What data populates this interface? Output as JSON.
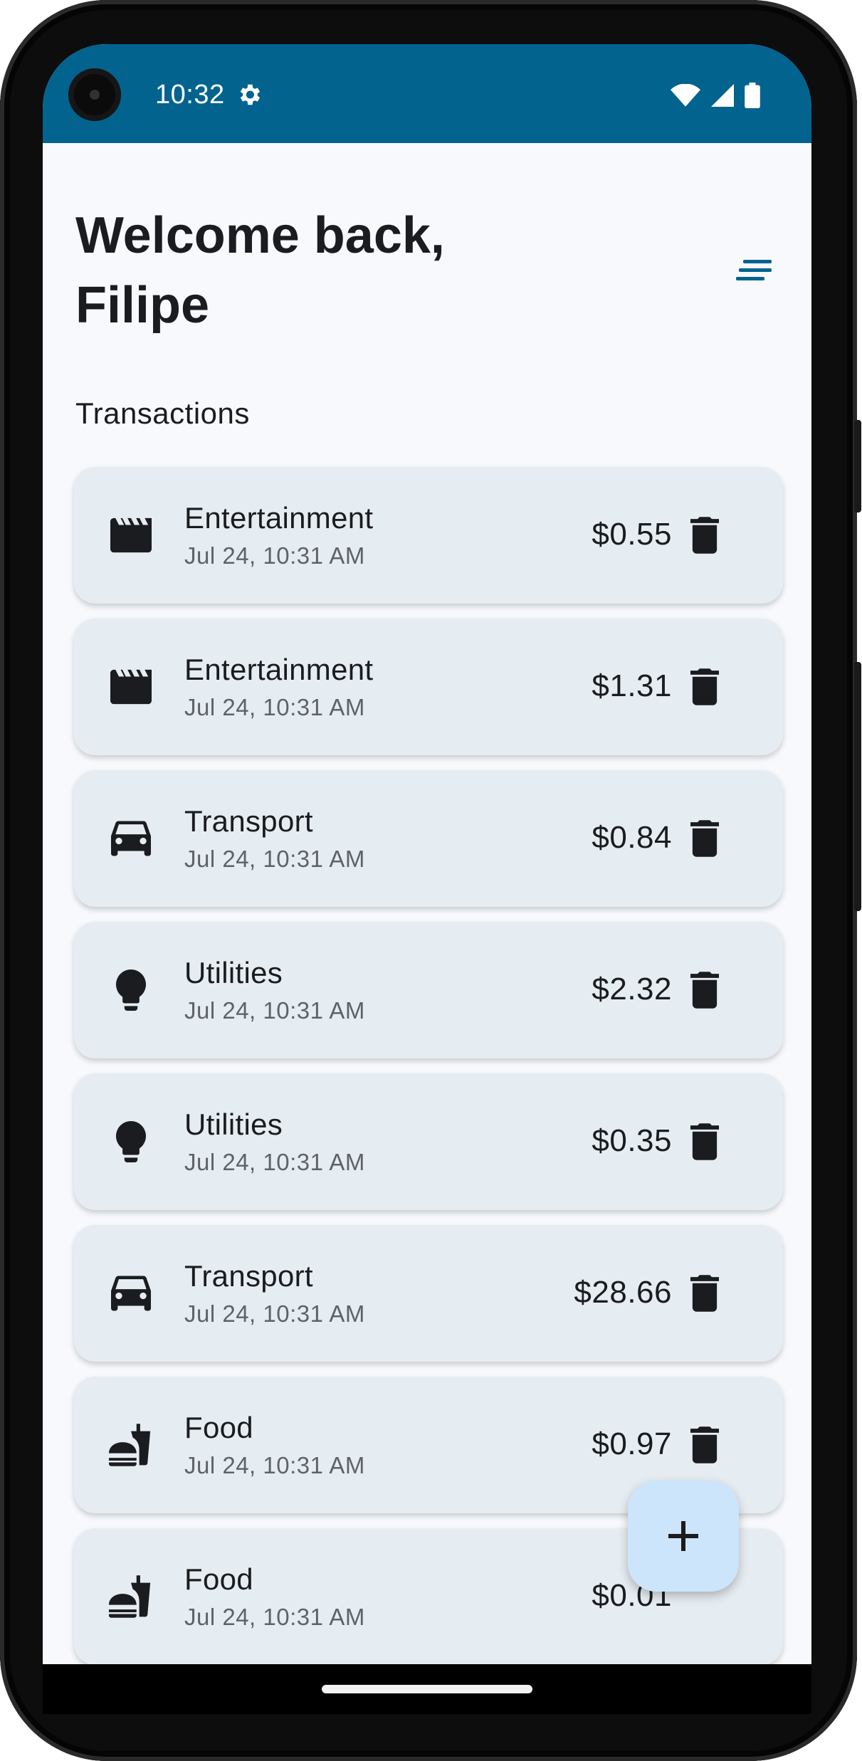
{
  "status_bar": {
    "time": "10:32",
    "icons": [
      "settings-gear-icon",
      "wifi-icon",
      "cellular-signal-icon",
      "battery-icon"
    ],
    "background_color": "#02638f"
  },
  "header": {
    "title": "Welcome back, Filipe",
    "sort_icon": "sort-icon"
  },
  "section": {
    "label": "Transactions"
  },
  "transactions": [
    {
      "category": "Entertainment",
      "date": "Jul 24, 10:31 AM",
      "amount": "$0.55",
      "icon": "movie-clapperboard-icon"
    },
    {
      "category": "Entertainment",
      "date": "Jul 24, 10:31 AM",
      "amount": "$1.31",
      "icon": "movie-clapperboard-icon"
    },
    {
      "category": "Transport",
      "date": "Jul 24, 10:31 AM",
      "amount": "$0.84",
      "icon": "car-icon"
    },
    {
      "category": "Utilities",
      "date": "Jul 24, 10:31 AM",
      "amount": "$2.32",
      "icon": "lightbulb-icon"
    },
    {
      "category": "Utilities",
      "date": "Jul 24, 10:31 AM",
      "amount": "$0.35",
      "icon": "lightbulb-icon"
    },
    {
      "category": "Transport",
      "date": "Jul 24, 10:31 AM",
      "amount": "$28.66",
      "icon": "car-icon"
    },
    {
      "category": "Food",
      "date": "Jul 24, 10:31 AM",
      "amount": "$0.97",
      "icon": "fastfood-icon"
    },
    {
      "category": "Food",
      "date": "Jul 24, 10:31 AM",
      "amount": "$0.01",
      "icon": "fastfood-icon"
    }
  ],
  "fab": {
    "icon": "plus-icon",
    "color": "#cde5fa"
  },
  "colors": {
    "accent": "#02638f",
    "card_background": "#e6edf2",
    "screen_background": "#f8f9fc"
  }
}
